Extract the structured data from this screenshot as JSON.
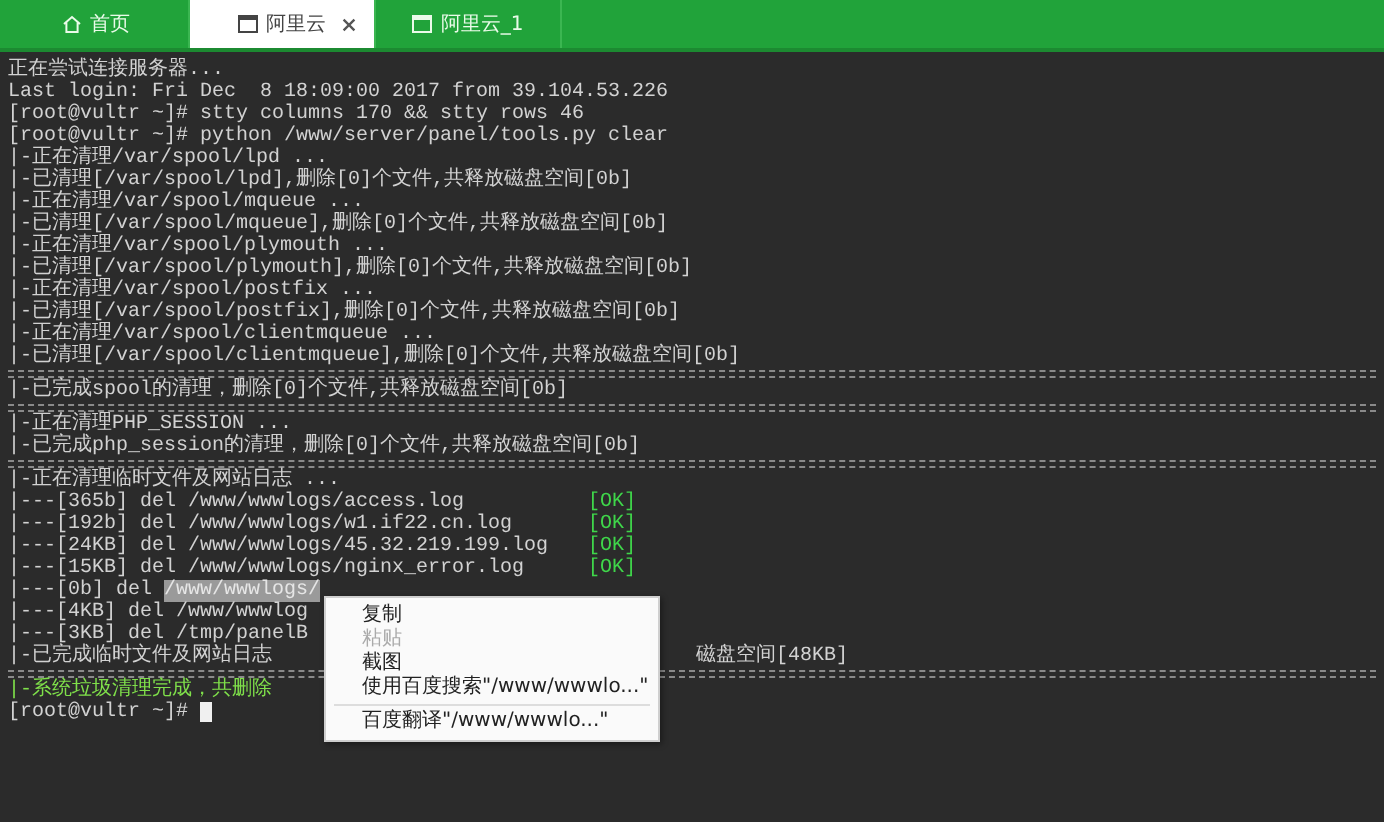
{
  "tabs": [
    {
      "label": "首页",
      "selected": false,
      "closable": false
    },
    {
      "label": "阿里云",
      "selected": true,
      "closable": true
    },
    {
      "label": "阿里云_1",
      "selected": false,
      "closable": false
    }
  ],
  "terminal": {
    "lines": [
      {
        "kind": "text",
        "segments": [
          {
            "text": "正在尝试连接服务器...",
            "kind": "plain"
          }
        ]
      },
      {
        "kind": "text",
        "segments": [
          {
            "text": "Last login: Fri Dec  8 18:09:00 2017 from 39.104.53.226",
            "kind": "plain"
          }
        ]
      },
      {
        "kind": "text",
        "segments": [
          {
            "text": "[root@vultr ~]# stty columns 170 && stty rows 46",
            "kind": "plain"
          }
        ]
      },
      {
        "kind": "text",
        "segments": [
          {
            "text": "[root@vultr ~]# python /www/server/panel/tools.py clear",
            "kind": "plain"
          }
        ]
      },
      {
        "kind": "text",
        "segments": [
          {
            "text": "|-正在清理/var/spool/lpd ...",
            "kind": "plain"
          }
        ]
      },
      {
        "kind": "text",
        "segments": [
          {
            "text": "|-已清理[/var/spool/lpd],删除[0]个文件,共释放磁盘空间[0b]",
            "kind": "plain"
          }
        ]
      },
      {
        "kind": "text",
        "segments": [
          {
            "text": "|-正在清理/var/spool/mqueue ...",
            "kind": "plain"
          }
        ]
      },
      {
        "kind": "text",
        "segments": [
          {
            "text": "|-已清理[/var/spool/mqueue],删除[0]个文件,共释放磁盘空间[0b]",
            "kind": "plain"
          }
        ]
      },
      {
        "kind": "text",
        "segments": [
          {
            "text": "|-正在清理/var/spool/plymouth ...",
            "kind": "plain"
          }
        ]
      },
      {
        "kind": "text",
        "segments": [
          {
            "text": "|-已清理[/var/spool/plymouth],删除[0]个文件,共释放磁盘空间[0b]",
            "kind": "plain"
          }
        ]
      },
      {
        "kind": "text",
        "segments": [
          {
            "text": "|-正在清理/var/spool/postfix ...",
            "kind": "plain"
          }
        ]
      },
      {
        "kind": "text",
        "segments": [
          {
            "text": "|-已清理[/var/spool/postfix],删除[0]个文件,共释放磁盘空间[0b]",
            "kind": "plain"
          }
        ]
      },
      {
        "kind": "text",
        "segments": [
          {
            "text": "|-正在清理/var/spool/clientmqueue ...",
            "kind": "plain"
          }
        ]
      },
      {
        "kind": "text",
        "segments": [
          {
            "text": "|-已清理[/var/spool/clientmqueue],删除[0]个文件,共释放磁盘空间[0b]",
            "kind": "plain"
          }
        ]
      },
      {
        "kind": "separator"
      },
      {
        "kind": "text",
        "segments": [
          {
            "text": "|-已完成spool的清理，删除[0]个文件,共释放磁盘空间[0b]",
            "kind": "plain"
          }
        ]
      },
      {
        "kind": "separator"
      },
      {
        "kind": "text",
        "segments": [
          {
            "text": "|-正在清理PHP_SESSION ...",
            "kind": "plain"
          }
        ]
      },
      {
        "kind": "text",
        "segments": [
          {
            "text": "|-已完成php_session的清理，删除[0]个文件,共释放磁盘空间[0b]",
            "kind": "plain"
          }
        ]
      },
      {
        "kind": "separator"
      },
      {
        "kind": "text",
        "segments": [
          {
            "text": "|-正在清理临时文件及网站日志 ...",
            "kind": "plain"
          }
        ]
      },
      {
        "kind": "text",
        "segments": [
          {
            "text": "|---[365b] del /www/wwwlogs/access.log",
            "kind": "plain"
          },
          {
            "text": "[OK]",
            "kind": "ok"
          }
        ]
      },
      {
        "kind": "text",
        "segments": [
          {
            "text": "|---[192b] del /www/wwwlogs/w1.if22.cn.log",
            "kind": "plain"
          },
          {
            "text": "[OK]",
            "kind": "ok"
          }
        ]
      },
      {
        "kind": "text",
        "segments": [
          {
            "text": "|---[24KB] del /www/wwwlogs/45.32.219.199.log",
            "kind": "plain"
          },
          {
            "text": "[OK]",
            "kind": "ok"
          }
        ]
      },
      {
        "kind": "text",
        "segments": [
          {
            "text": "|---[15KB] del /www/wwwlogs/nginx_error.log",
            "kind": "plain"
          },
          {
            "text": "[OK]",
            "kind": "ok"
          }
        ]
      },
      {
        "kind": "text",
        "segments": [
          {
            "text": "|---[0b] del ",
            "kind": "plain"
          },
          {
            "text": "/www/wwwlogs/",
            "kind": "selected"
          }
        ]
      },
      {
        "kind": "text",
        "segments": [
          {
            "text": "|---[4KB] del /www/wwwlog",
            "kind": "plain"
          }
        ]
      },
      {
        "kind": "text",
        "segments": [
          {
            "text": "|---[3KB] del /tmp/panelB",
            "kind": "plain"
          }
        ]
      },
      {
        "kind": "text",
        "segments": [
          {
            "text": "|-已完成临时文件及网站日志",
            "kind": "plain"
          },
          {
            "text": "磁盘空间[48KB]",
            "kind": "after-menu"
          }
        ]
      },
      {
        "kind": "separator"
      },
      {
        "kind": "text",
        "segments": [
          {
            "text": "|-系统垃圾清理完成，共删除",
            "kind": "green"
          }
        ]
      },
      {
        "kind": "prompt",
        "cursor": true,
        "segments": [
          {
            "text": "[root@vultr ~]#",
            "kind": "plain"
          }
        ]
      }
    ]
  },
  "context_menu": {
    "items": [
      {
        "kind": "item",
        "label": "复制",
        "disabled": false
      },
      {
        "kind": "item",
        "label": "粘贴",
        "disabled": true
      },
      {
        "kind": "item",
        "label": "截图",
        "disabled": false
      },
      {
        "kind": "item",
        "label": "使用百度搜索\"/www/wwwlo...\"",
        "disabled": false
      },
      {
        "kind": "divider"
      },
      {
        "kind": "item",
        "label": "百度翻译\"/www/wwwlo...\"",
        "disabled": false
      }
    ]
  }
}
